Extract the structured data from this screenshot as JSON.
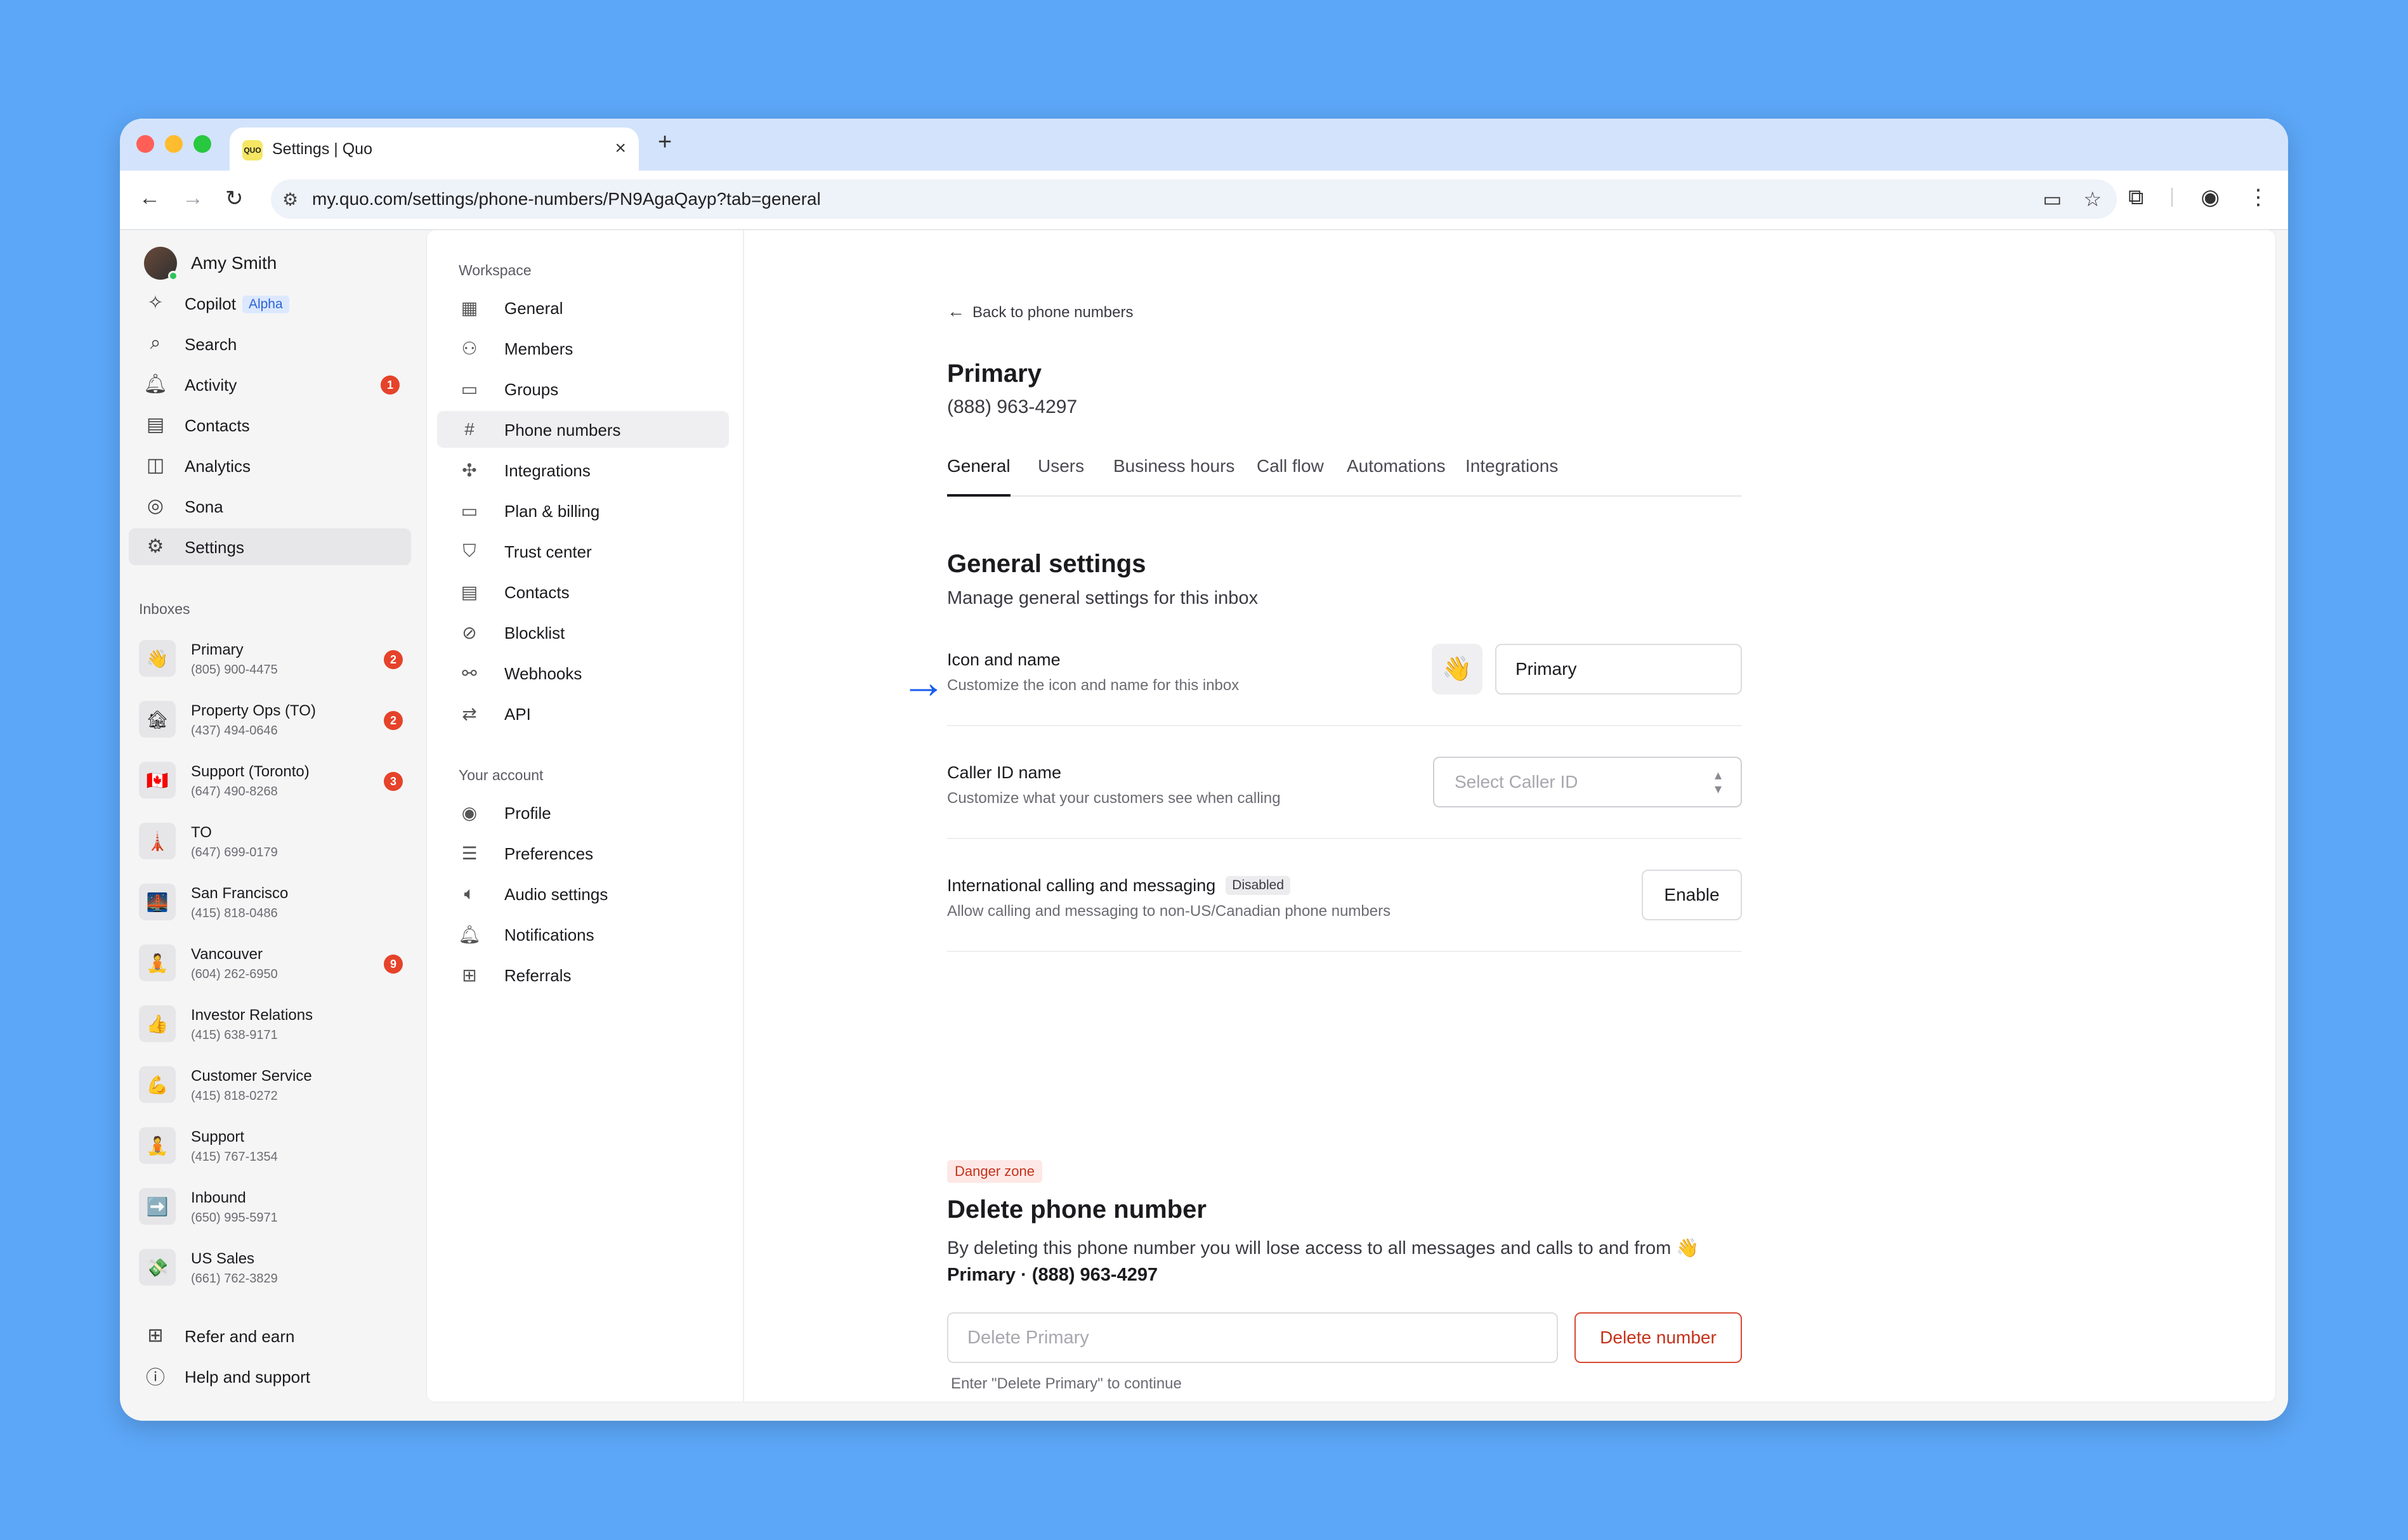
{
  "browser": {
    "tab_title": "Settings | Quo",
    "favicon_text": "QUO",
    "url": "my.quo.com/settings/phone-numbers/PN9AgaQayp?tab=general",
    "new_tab_glyph": "+",
    "close_glyph": "×"
  },
  "sidebar": {
    "user_name": "Amy Smith",
    "nav": [
      {
        "label": "Copilot",
        "icon": "sparkle-icon",
        "badge": "Alpha"
      },
      {
        "label": "Search",
        "icon": "search-icon"
      },
      {
        "label": "Activity",
        "icon": "bell-icon",
        "count": "1"
      },
      {
        "label": "Contacts",
        "icon": "contacts-icon"
      },
      {
        "label": "Analytics",
        "icon": "analytics-icon"
      },
      {
        "label": "Sona",
        "icon": "sona-icon"
      },
      {
        "label": "Settings",
        "icon": "gear-icon",
        "active": true
      }
    ],
    "inboxes_label": "Inboxes",
    "inboxes": [
      {
        "name": "Primary",
        "phone": "(805) 900-4475",
        "icon": "👋",
        "count": "2"
      },
      {
        "name": "Property Ops (TO)",
        "phone": "(437) 494-0646",
        "icon": "🏚",
        "count": "2"
      },
      {
        "name": "Support (Toronto)",
        "phone": "(647) 490-8268",
        "icon": "🇨🇦",
        "count": "3"
      },
      {
        "name": "TO",
        "phone": "(647) 699-0179",
        "icon": "🗼"
      },
      {
        "name": "San Francisco",
        "phone": "(415) 818-0486",
        "icon": "🌉"
      },
      {
        "name": "Vancouver",
        "phone": "(604) 262-6950",
        "icon": "🧘",
        "count": "9"
      },
      {
        "name": "Investor Relations",
        "phone": "(415) 638-9171",
        "icon": "👍"
      },
      {
        "name": "Customer Service",
        "phone": "(415) 818-0272",
        "icon": "💪"
      },
      {
        "name": "Support",
        "phone": "(415) 767-1354",
        "icon": "🧘"
      },
      {
        "name": "Inbound",
        "phone": "(650) 995-5971",
        "icon": "➡️"
      },
      {
        "name": "US Sales",
        "phone": "(661) 762-3829",
        "icon": "💸"
      }
    ],
    "bottom": [
      {
        "label": "Refer and earn",
        "icon": "gift-icon"
      },
      {
        "label": "Help and support",
        "icon": "help-icon"
      }
    ]
  },
  "settings_menu": {
    "workspace_label": "Workspace",
    "workspace": [
      {
        "label": "General",
        "icon": "building-icon"
      },
      {
        "label": "Members",
        "icon": "members-icon"
      },
      {
        "label": "Groups",
        "icon": "folder-icon"
      },
      {
        "label": "Phone numbers",
        "icon": "hash-icon",
        "active": true
      },
      {
        "label": "Integrations",
        "icon": "integrations-icon"
      },
      {
        "label": "Plan & billing",
        "icon": "billing-icon"
      },
      {
        "label": "Trust center",
        "icon": "shield-icon"
      },
      {
        "label": "Contacts",
        "icon": "contacts-icon"
      },
      {
        "label": "Blocklist",
        "icon": "block-icon"
      },
      {
        "label": "Webhooks",
        "icon": "webhooks-icon"
      },
      {
        "label": "API",
        "icon": "api-icon"
      }
    ],
    "account_label": "Your account",
    "account": [
      {
        "label": "Profile",
        "icon": "profile-icon"
      },
      {
        "label": "Preferences",
        "icon": "sliders-icon"
      },
      {
        "label": "Audio settings",
        "icon": "speaker-icon"
      },
      {
        "label": "Notifications",
        "icon": "bell-icon"
      },
      {
        "label": "Referrals",
        "icon": "gift-icon"
      }
    ]
  },
  "main": {
    "back_link": "Back to phone numbers",
    "title": "Primary",
    "number": "(888) 963-4297",
    "tabs": [
      "General",
      "Users",
      "Business hours",
      "Call flow",
      "Automations",
      "Integrations"
    ],
    "active_tab": "General",
    "general": {
      "title": "General settings",
      "description": "Manage general settings for this inbox",
      "icon_name": {
        "title": "Icon and name",
        "subtitle": "Customize the icon and name for this inbox",
        "emoji": "👋",
        "name_value": "Primary"
      },
      "caller_id": {
        "title": "Caller ID name",
        "subtitle": "Customize what your customers see when calling",
        "placeholder": "Select Caller ID"
      },
      "international": {
        "title": "International calling and messaging",
        "badge": "Disabled",
        "subtitle": "Allow calling and messaging to non-US/Canadian phone numbers",
        "button": "Enable"
      }
    },
    "danger": {
      "badge": "Danger zone",
      "title": "Delete phone number",
      "desc_prefix": "By deleting this phone number you will lose access to all messages and calls to and from ",
      "desc_emoji": "👋",
      "desc_strong": "Primary · (888) 963-4297",
      "input_placeholder": "Delete Primary",
      "button": "Delete number",
      "hint": "Enter \"Delete Primary\" to continue"
    }
  },
  "colors": {
    "background": "#5ca7f8",
    "accent_blue": "#1a5cf0",
    "danger_red": "#c4321b",
    "badge_red": "#e5432a"
  }
}
